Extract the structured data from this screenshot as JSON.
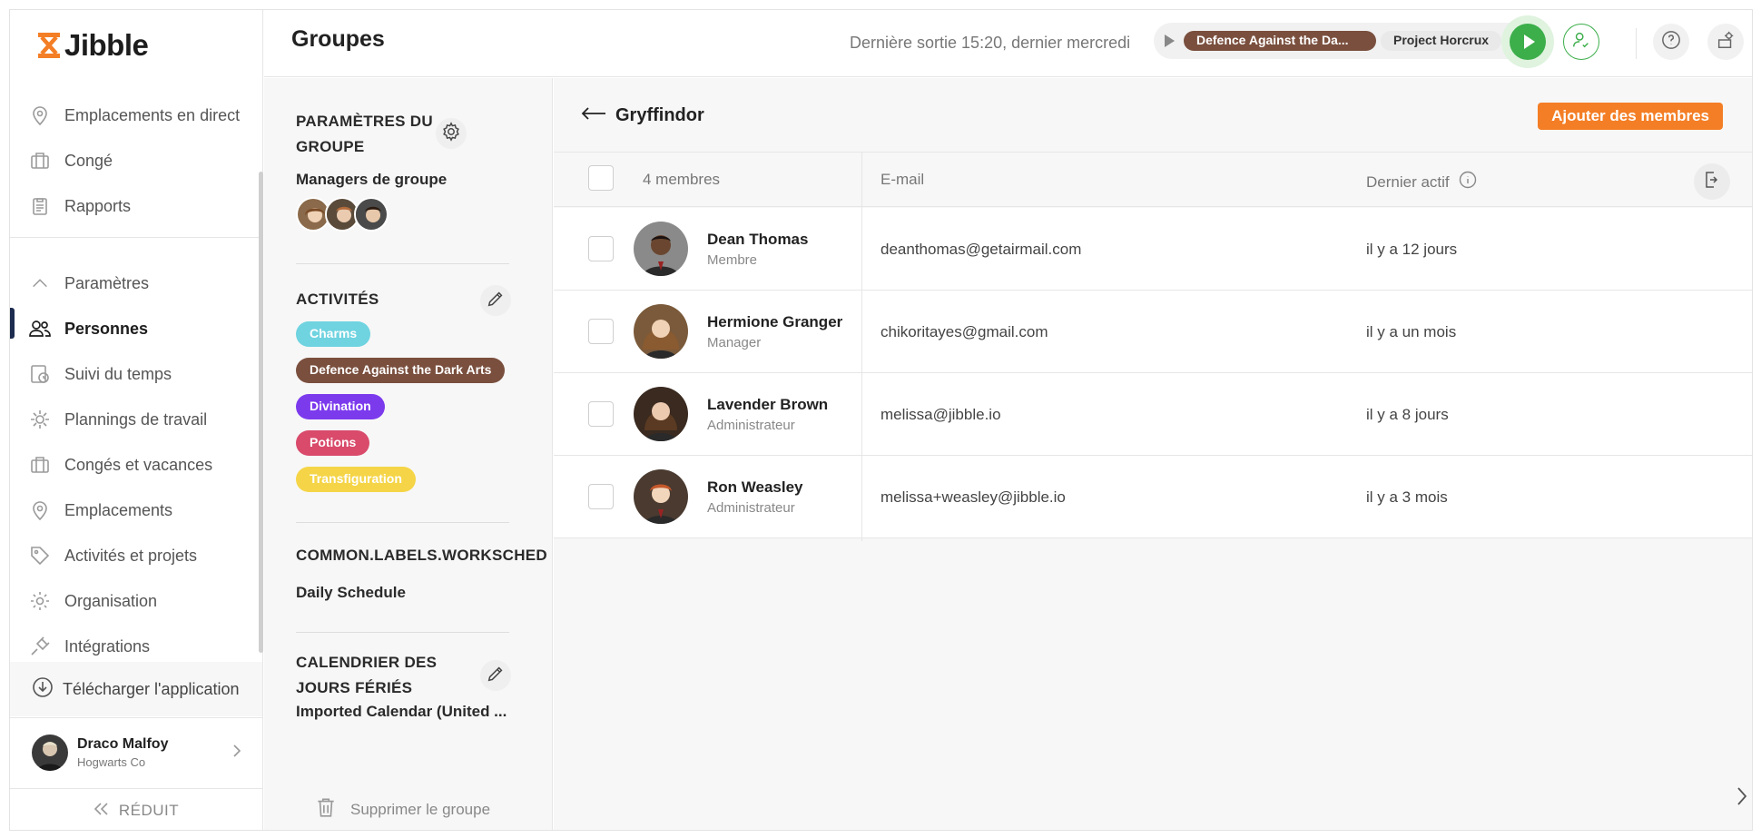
{
  "app": {
    "logo_text": "Jibble",
    "brand_color": "#f47e25"
  },
  "sidebar": {
    "items": [
      {
        "label": "Emplacements en direct",
        "icon": "map-pin-icon"
      },
      {
        "label": "Congé",
        "icon": "briefcase-icon"
      },
      {
        "label": "Rapports",
        "icon": "clipboard-icon"
      },
      {
        "label": "Paramètres",
        "icon": "chevron-up-icon"
      },
      {
        "label": "Personnes",
        "icon": "people-icon",
        "active": true
      },
      {
        "label": "Suivi du temps",
        "icon": "timesheet-icon"
      },
      {
        "label": "Plannings de travail",
        "icon": "schedule-icon"
      },
      {
        "label": "Congés et vacances",
        "icon": "briefcase-icon"
      },
      {
        "label": "Emplacements",
        "icon": "map-pin-icon"
      },
      {
        "label": "Activités et projets",
        "icon": "tag-icon"
      },
      {
        "label": "Organisation",
        "icon": "gear-icon"
      },
      {
        "label": "Intégrations",
        "icon": "plug-icon"
      }
    ],
    "download_label": "Télécharger l'application",
    "profile": {
      "name": "Draco Malfoy",
      "org": "Hogwarts Co"
    },
    "collapse_label": "RÉDUIT"
  },
  "header": {
    "title": "Groupes",
    "last_out": "Dernière sortie 15:20, dernier mercredi",
    "timer": {
      "activity": "Defence Against the Da...",
      "project": "Project Horcrux",
      "activity_color": "#7a4f3e"
    },
    "play_color": "#3cae4a"
  },
  "group_panel": {
    "settings_title": "PARAMÈTRES DU GROUPE",
    "managers_label": "Managers de groupe",
    "activities_title": "ACTIVITÉS",
    "activities": [
      {
        "label": "Charms",
        "color": "#6fd3e0"
      },
      {
        "label": "Defence Against the Dark Arts",
        "color": "#7a4f3e"
      },
      {
        "label": "Divination",
        "color": "#7c3aed"
      },
      {
        "label": "Potions",
        "color": "#d94a6b"
      },
      {
        "label": "Transfiguration",
        "color": "#f5d547"
      }
    ],
    "worksched_title": "COMMON.LABELS.WORKSCHED",
    "worksched_value": "Daily Schedule",
    "holidays_title": "CALENDRIER DES JOURS FÉRIÉS",
    "holidays_value": "Imported Calendar (United ...",
    "delete_label": "Supprimer le groupe"
  },
  "main": {
    "group_name": "Gryffindor",
    "add_button": "Ajouter des membres",
    "columns": {
      "members": "4 membres",
      "email": "E-mail",
      "last_active": "Dernier actif"
    },
    "members": [
      {
        "name": "Dean Thomas",
        "role": "Membre",
        "email": "deanthomas@getairmail.com",
        "last_active": "il y a 12 jours"
      },
      {
        "name": "Hermione Granger",
        "role": "Manager",
        "email": "chikoritayes@gmail.com",
        "last_active": "il y a un mois"
      },
      {
        "name": "Lavender Brown",
        "role": "Administrateur",
        "email": "melissa@jibble.io",
        "last_active": "il y a 8 jours"
      },
      {
        "name": "Ron Weasley",
        "role": "Administrateur",
        "email": "melissa+weasley@jibble.io",
        "last_active": "il y a 3 mois"
      }
    ]
  }
}
